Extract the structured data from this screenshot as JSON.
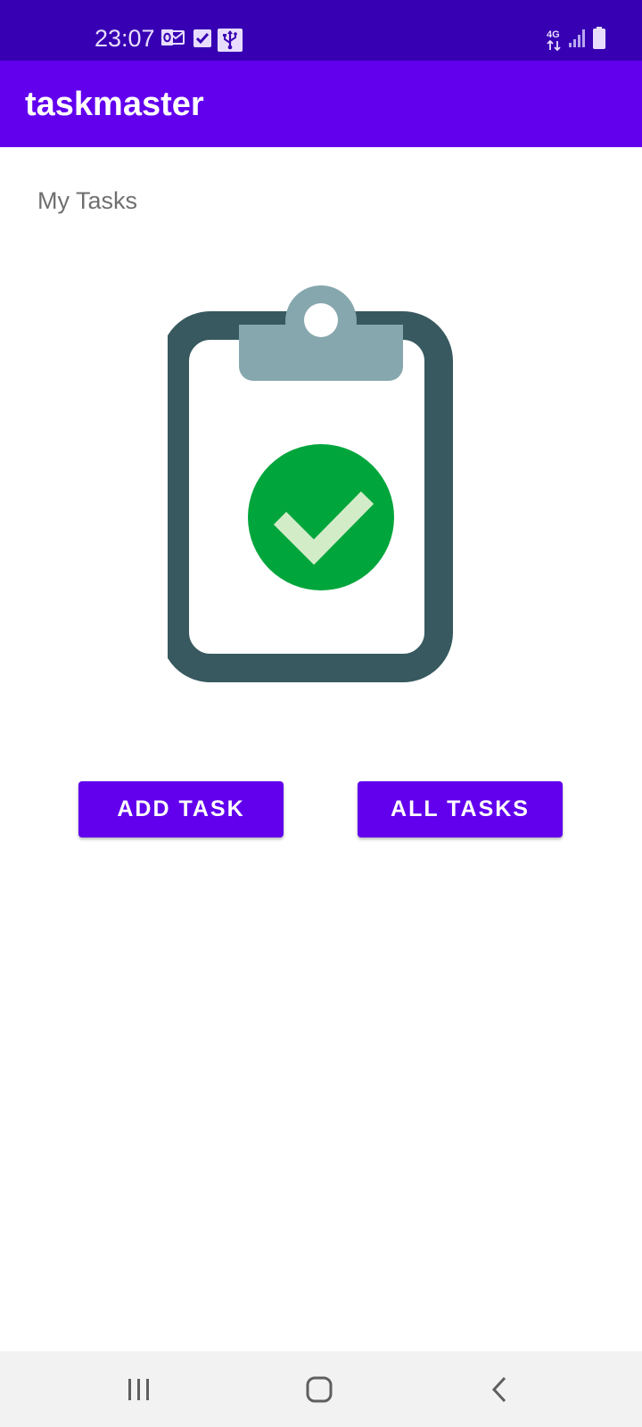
{
  "status_bar": {
    "time": "23:07",
    "network": "4G",
    "left_icons": [
      "outlook-icon",
      "task-check-icon",
      "usb-icon"
    ],
    "right_icons": [
      "network-4g-icon",
      "signal-icon",
      "battery-icon"
    ]
  },
  "app_bar": {
    "title": "taskmaster"
  },
  "main": {
    "section_label": "My Tasks",
    "illustration": "clipboard-check-icon",
    "add_task_label": "ADD TASK",
    "all_tasks_label": "ALL TASKS"
  },
  "nav_bar": {
    "icons": [
      "recents-icon",
      "home-icon",
      "back-icon"
    ]
  },
  "colors": {
    "status_bar": "#3700b3",
    "primary": "#6200ee",
    "clipboard_frame": "#37595f",
    "clipboard_clip": "#87a7ae",
    "check_green": "#00a53c",
    "check_mark": "#d3ecc8"
  }
}
